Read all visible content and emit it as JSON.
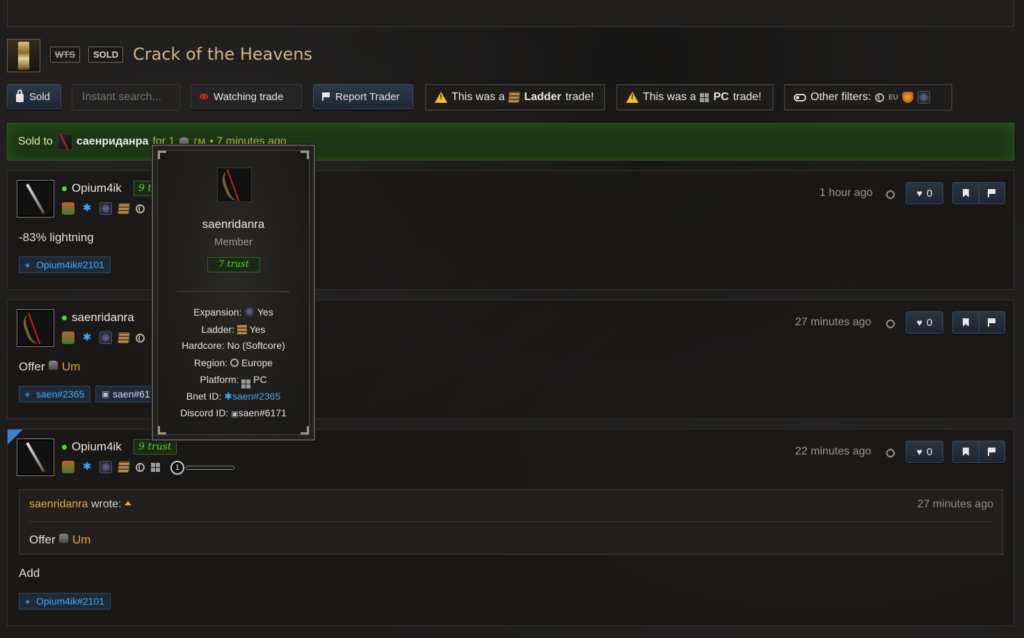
{
  "header": {
    "tag_wts": "WTS",
    "tag_sold": "SOLD",
    "title": "Crack of the Heavens"
  },
  "toolbar": {
    "sold_label": "Sold",
    "search_placeholder": "Instant search...",
    "watching_label": "Watching trade",
    "report_label": "Report Trader",
    "ladder_notice_pre": "This was a",
    "ladder_notice_strong": "Ladder",
    "ladder_notice_post": "trade!",
    "pc_notice_pre": "This was a",
    "pc_notice_strong": "PC",
    "pc_notice_post": "trade!",
    "filters_label": "Other filters:",
    "filters_region": "EU"
  },
  "sold_bar": {
    "label": "Sold to",
    "buyer": "саенриданра",
    "price_prefix": "for 1",
    "price_item": "гм",
    "time": "• 7 minutes ago"
  },
  "posts": [
    {
      "username": "Opium4ik",
      "trust": "9 trust",
      "time": "1 hour ago",
      "likes": "0",
      "body": "-83% lightning",
      "contacts": [
        "Opium4ik#2101"
      ]
    },
    {
      "username": "saenridanra",
      "time": "27 minutes ago",
      "likes": "0",
      "body_prefix": "Offer",
      "body_item": "Um",
      "contacts": [
        "saen#2365",
        "saen#6171"
      ]
    },
    {
      "username": "Opium4ik",
      "trust": "9 trust",
      "time": "22 minutes ago",
      "likes": "0",
      "slider_value": "1",
      "quote": {
        "author": "saenridanra",
        "wrote": "wrote:",
        "time": "27 minutes ago",
        "body_prefix": "Offer",
        "body_item": "Um"
      },
      "body": "Add",
      "contacts": [
        "Opium4ik#2101"
      ]
    }
  ],
  "tooltip": {
    "name": "saenridanra",
    "role": "Member",
    "trust": "7 trust",
    "rows": [
      {
        "label": "Expansion:",
        "value": "Yes"
      },
      {
        "label": "Ladder:",
        "value": "Yes"
      },
      {
        "label": "Hardcore:",
        "value": "No (Softcore)"
      },
      {
        "label": "Region:",
        "value": "Europe"
      },
      {
        "label": "Platform:",
        "value": "PC"
      },
      {
        "label": "Bnet ID:",
        "value": "saen#2365"
      },
      {
        "label": "Discord ID:",
        "value": "saen#6171"
      }
    ]
  },
  "colors": {
    "accent_blue": "#3ea6ff",
    "trust_green": "#54d22c",
    "gold": "#e8a33b",
    "title_tan": "#d3b38a",
    "warn_yellow": "#f2c418"
  }
}
